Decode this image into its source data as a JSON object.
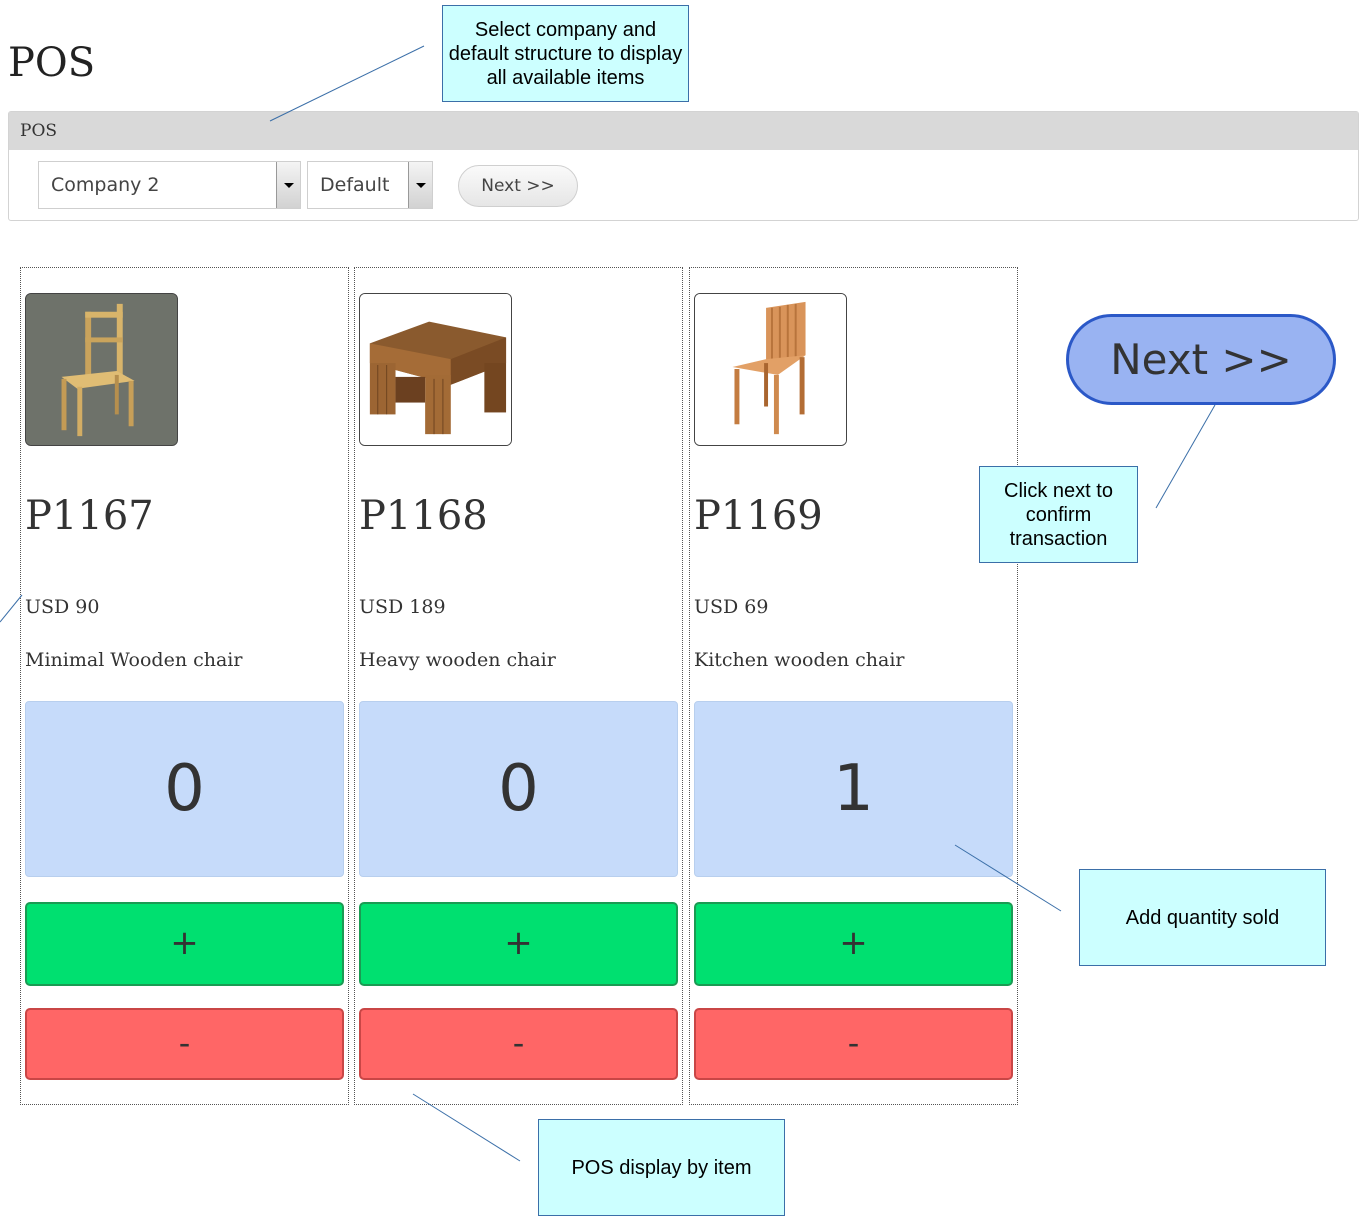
{
  "page": {
    "title": "POS"
  },
  "panel": {
    "header": "POS",
    "company_select": "Company 2",
    "structure_select": "Default",
    "next_button": "Next >>"
  },
  "items": [
    {
      "code": "P1167",
      "price": "USD 90",
      "description": "Minimal Wooden chair",
      "quantity": "0",
      "plus_label": "+",
      "minus_label": "-"
    },
    {
      "code": "P1168",
      "price": "USD 189",
      "description": "Heavy wooden chair",
      "quantity": "0",
      "plus_label": "+",
      "minus_label": "-"
    },
    {
      "code": "P1169",
      "price": "USD 69",
      "description": "Kitchen wooden chair",
      "quantity": "1",
      "plus_label": "+",
      "minus_label": "-"
    }
  ],
  "confirm_button": "Next >>",
  "annotations": {
    "select_company": "Select company and default structure to display all available items",
    "click_next": "Click next to confirm transaction",
    "add_quantity": "Add quantity sold",
    "pos_display": "POS display  by item"
  },
  "colors": {
    "panel_header_bg": "#d9d9d9",
    "quantity_bg": "#c6dbfa",
    "plus_bg": "#00e070",
    "minus_bg": "#ff6666",
    "next_bg": "#99b3f2",
    "callout_bg": "#ccffff"
  }
}
